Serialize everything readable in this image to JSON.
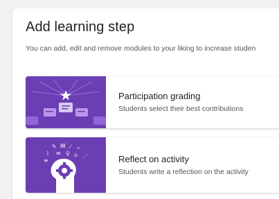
{
  "dialog": {
    "title": "Add learning step",
    "subtitle": "You can add, edit and remove modules to your liking to increase studen"
  },
  "modules": [
    {
      "title": "Participation grading",
      "description": "Students select their best contributions",
      "icon": "star-podium-icon"
    },
    {
      "title": "Reflect on activity",
      "description": "Students write a reflection on the activity",
      "icon": "head-gear-icon"
    }
  ],
  "colors": {
    "thumb_background": "#6b3fb3",
    "thumb_accent": "#9b6fe0"
  }
}
